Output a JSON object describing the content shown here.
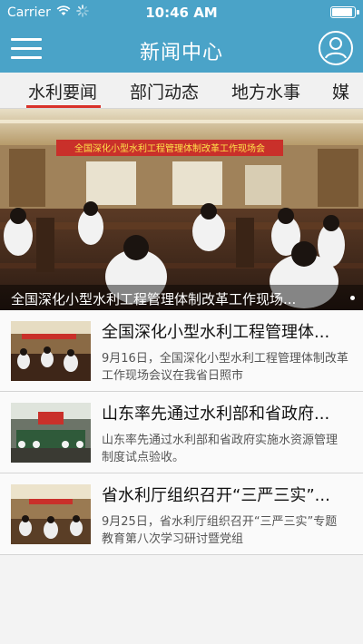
{
  "status_bar": {
    "carrier": "Carrier",
    "time": "10:46 AM",
    "icons": [
      "wifi-icon",
      "loading-spinner-icon",
      "battery-icon"
    ]
  },
  "nav": {
    "title": "新闻中心",
    "left_icon": "hamburger-menu-icon",
    "right_icon": "user-profile-icon"
  },
  "tabs": [
    {
      "label": "水利要闻",
      "active": true
    },
    {
      "label": "部门动态",
      "active": false
    },
    {
      "label": "地方水事",
      "active": false
    },
    {
      "label": "媒",
      "active": false
    }
  ],
  "banner": {
    "caption": "全国深化小型水利工程管理体制改革工作现场...",
    "photo_banner_text": "全国深化小型水利工程管理体制改革工作现场会"
  },
  "news": [
    {
      "title": "全国深化小型水利工程管理体...",
      "summary": "9月16日，全国深化小型水利工程管理体制改革工作现场会议在我省日照市"
    },
    {
      "title": "山东率先通过水利部和省政府...",
      "summary": "山东率先通过水利部和省政府实施水资源管理制度试点验收。"
    },
    {
      "title": "省水利厅组织召开“三严三实”...",
      "summary": "9月25日，省水利厅组织召开“三严三实”专题教育第八次学习研讨暨党组"
    }
  ],
  "colors": {
    "header_blue": "#4aa3c8",
    "tab_underline_red": "#d9322a",
    "banner_red": "#c9302a"
  }
}
